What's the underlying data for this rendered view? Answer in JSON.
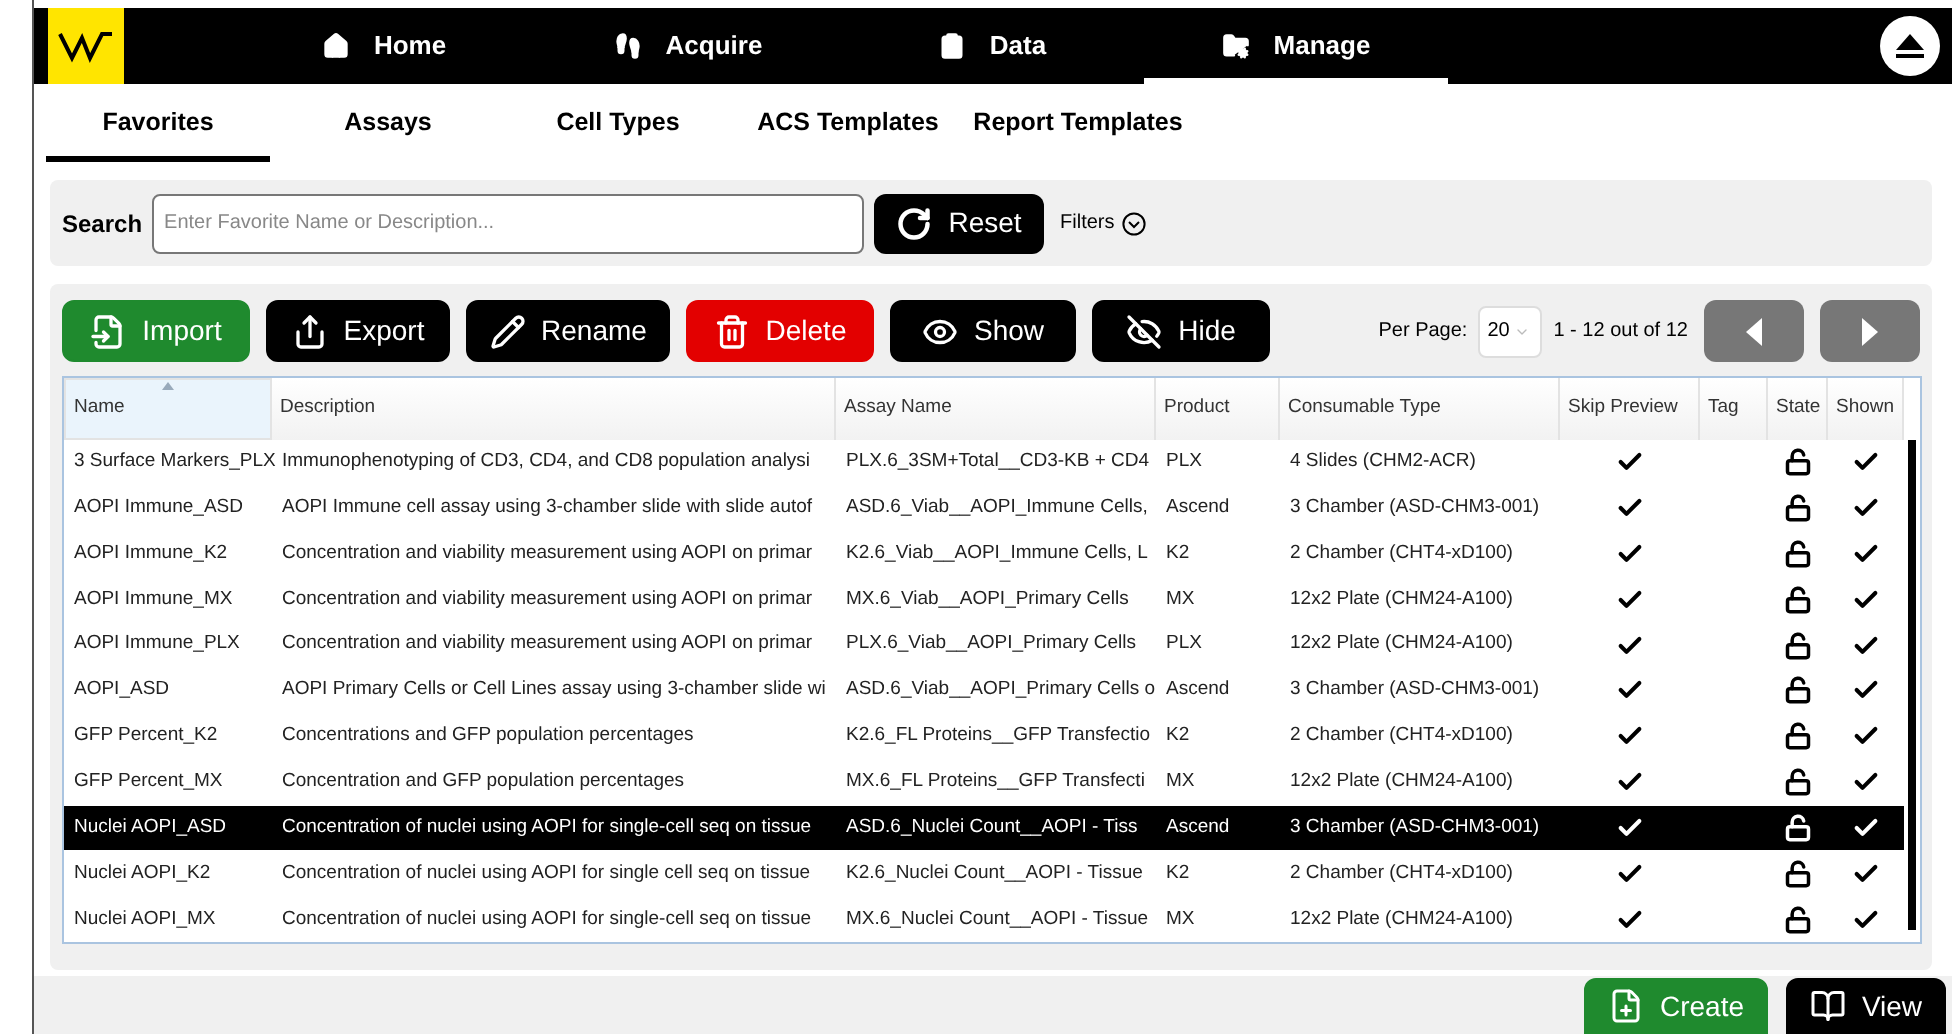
{
  "nav": [
    {
      "label": "Home",
      "selected": false
    },
    {
      "label": "Acquire",
      "selected": false
    },
    {
      "label": "Data",
      "selected": false
    },
    {
      "label": "Manage",
      "selected": true
    }
  ],
  "tabs": [
    {
      "label": "Favorites",
      "selected": true
    },
    {
      "label": "Assays",
      "selected": false
    },
    {
      "label": "Cell Types",
      "selected": false
    },
    {
      "label": "ACS Templates",
      "selected": false
    },
    {
      "label": "Report Templates",
      "selected": false
    }
  ],
  "search": {
    "label": "Search",
    "placeholder": "Enter Favorite Name or Description...",
    "reset": "Reset",
    "filters": "Filters"
  },
  "toolbar": [
    {
      "label": "Import",
      "kind": "success"
    },
    {
      "label": "Export",
      "kind": "default"
    },
    {
      "label": "Rename",
      "kind": "default"
    },
    {
      "label": "Delete",
      "kind": "danger"
    },
    {
      "label": "Show",
      "kind": "default"
    },
    {
      "label": "Hide",
      "kind": "default"
    }
  ],
  "pagination": {
    "label": "Per Page:",
    "per_page": "20",
    "range": "1 - 12 out of 12",
    "prev_disabled": true,
    "next_disabled": true
  },
  "table": {
    "columns": [
      "Name",
      "Description",
      "Assay Name",
      "Product",
      "Consumable Type",
      "Skip Preview",
      "Tag",
      "State",
      "Shown"
    ],
    "rows": [
      {
        "name": "3 Surface Markers_PLX",
        "description": "Immunophenotyping of CD3, CD4, and CD8 population analysi",
        "assay": "PLX.6_3SM+Total__CD3-KB + CD4",
        "product": "PLX",
        "consumable": "4 Slides (CHM2-ACR)",
        "skip_preview": true,
        "locked": false,
        "shown": true,
        "selected": false
      },
      {
        "name": "AOPI Immune_ASD",
        "description": "AOPI Immune cell assay using 3-chamber slide with slide autof",
        "assay": "ASD.6_Viab__AOPI_Immune Cells,",
        "product": "Ascend",
        "consumable": "3 Chamber (ASD-CHM3-001)",
        "skip_preview": true,
        "locked": false,
        "shown": true,
        "selected": false
      },
      {
        "name": "AOPI Immune_K2",
        "description": "Concentration and viability measurement using AOPI on primar",
        "assay": "K2.6_Viab__AOPI_Immune Cells, L",
        "product": "K2",
        "consumable": "2 Chamber (CHT4-xD100)",
        "skip_preview": true,
        "locked": false,
        "shown": true,
        "selected": false
      },
      {
        "name": "AOPI Immune_MX",
        "description": "Concentration and viability measurement using AOPI on primar",
        "assay": "MX.6_Viab__AOPI_Primary Cells",
        "product": "MX",
        "consumable": "12x2 Plate (CHM24-A100)",
        "skip_preview": true,
        "locked": false,
        "shown": true,
        "selected": false
      },
      {
        "name": "AOPI Immune_PLX",
        "description": "Concentration and viability measurement using AOPI on primar",
        "assay": "PLX.6_Viab__AOPI_Primary Cells",
        "product": "PLX",
        "consumable": "12x2 Plate (CHM24-A100)",
        "skip_preview": true,
        "locked": false,
        "shown": true,
        "selected": false
      },
      {
        "name": "AOPI_ASD",
        "description": "AOPI Primary Cells or Cell Lines assay using 3-chamber slide wi",
        "assay": "ASD.6_Viab__AOPI_Primary Cells o",
        "product": "Ascend",
        "consumable": "3 Chamber (ASD-CHM3-001)",
        "skip_preview": true,
        "locked": false,
        "shown": true,
        "selected": false
      },
      {
        "name": "GFP Percent_K2",
        "description": "Concentrations and GFP population percentages",
        "assay": "K2.6_FL Proteins__GFP Transfectio",
        "product": "K2",
        "consumable": "2 Chamber (CHT4-xD100)",
        "skip_preview": true,
        "locked": false,
        "shown": true,
        "selected": false
      },
      {
        "name": "GFP Percent_MX",
        "description": "Concentration and GFP population percentages",
        "assay": "MX.6_FL Proteins__GFP Transfecti",
        "product": "MX",
        "consumable": "12x2 Plate (CHM24-A100)",
        "skip_preview": true,
        "locked": false,
        "shown": true,
        "selected": false
      },
      {
        "name": "Nuclei AOPI_ASD",
        "description": "Concentration of nuclei using AOPI for single-cell seq on tissue",
        "assay": "ASD.6_Nuclei Count__AOPI - Tiss",
        "product": "Ascend",
        "consumable": "3 Chamber (ASD-CHM3-001)",
        "skip_preview": true,
        "locked": false,
        "shown": true,
        "selected": true
      },
      {
        "name": "Nuclei AOPI_K2",
        "description": "Concentration of nuclei using AOPI for single cell seq on tissue",
        "assay": "K2.6_Nuclei Count__AOPI - Tissue",
        "product": "K2",
        "consumable": "2 Chamber (CHT4-xD100)",
        "skip_preview": true,
        "locked": false,
        "shown": true,
        "selected": false
      },
      {
        "name": "Nuclei AOPI_MX",
        "description": "Concentration of nuclei using AOPI for single-cell seq on tissue",
        "assay": "MX.6_Nuclei Count__AOPI - Tissue",
        "product": "MX",
        "consumable": "12x2 Plate (CHM24-A100)",
        "skip_preview": true,
        "locked": false,
        "shown": true,
        "selected": false
      }
    ]
  },
  "footer": [
    {
      "label": "Create",
      "kind": "success"
    },
    {
      "label": "View",
      "kind": "default"
    }
  ]
}
